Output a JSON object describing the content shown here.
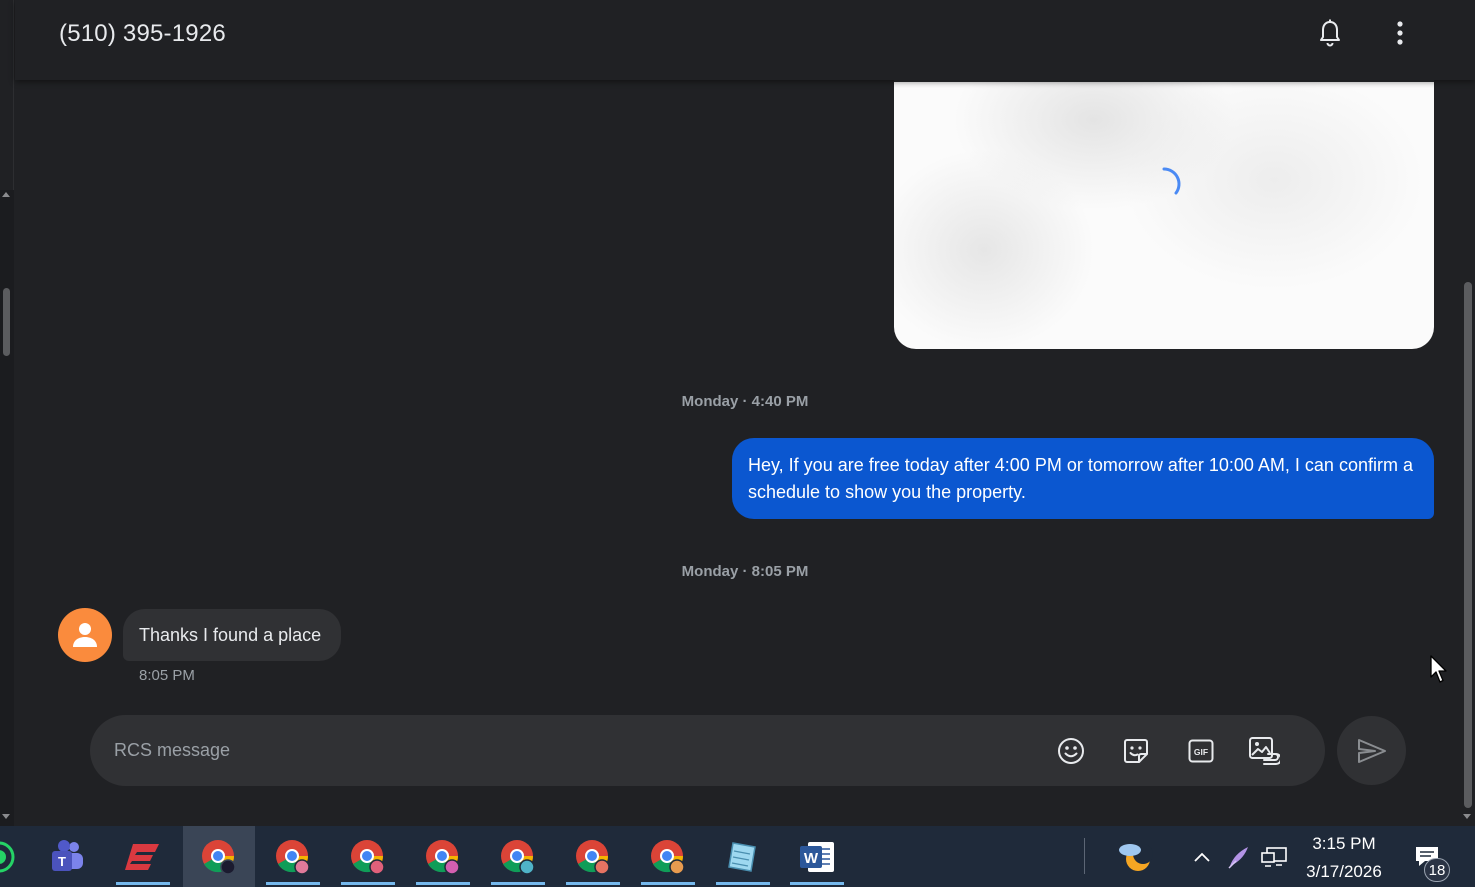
{
  "header": {
    "contact": "(510) 395-1926",
    "icons": [
      "bell-icon",
      "more-vert-icon"
    ]
  },
  "conversation": {
    "attachment": {
      "state": "loading",
      "icon": "spinner-icon"
    },
    "divider_1": "Monday · 4:40 PM",
    "outgoing_message": "Hey, If you are free today after 4:00 PM or tomorrow after 10:00 AM, I can confirm a schedule to show you the property.",
    "divider_2": "Monday · 8:05 PM",
    "incoming_message": "Thanks I found a place",
    "incoming_time": "8:05 PM"
  },
  "composer": {
    "placeholder": "RCS message",
    "value": "",
    "icons": [
      "emoji-icon",
      "sticker-icon",
      "gif-icon",
      "gallery-icon",
      "send-icon"
    ]
  },
  "taskbar": {
    "apps": [
      "whatsapp",
      "teams",
      "expressvpn",
      "chrome",
      "chrome",
      "chrome",
      "chrome",
      "chrome",
      "chrome",
      "chrome",
      "notepad",
      "word"
    ],
    "tray_icons": [
      "weather-icon",
      "chevron-up-icon",
      "pen-icon",
      "network-icon",
      "notification-icon"
    ],
    "time": "3:15 PM",
    "date": "3/17/2026",
    "notification_count": "18"
  },
  "colors": {
    "background": "#202124",
    "outgoing_bubble": "#0b57d0",
    "incoming_bubble": "#303134",
    "avatar": "#fa8b3d",
    "taskbar": "#1f2a3a"
  }
}
